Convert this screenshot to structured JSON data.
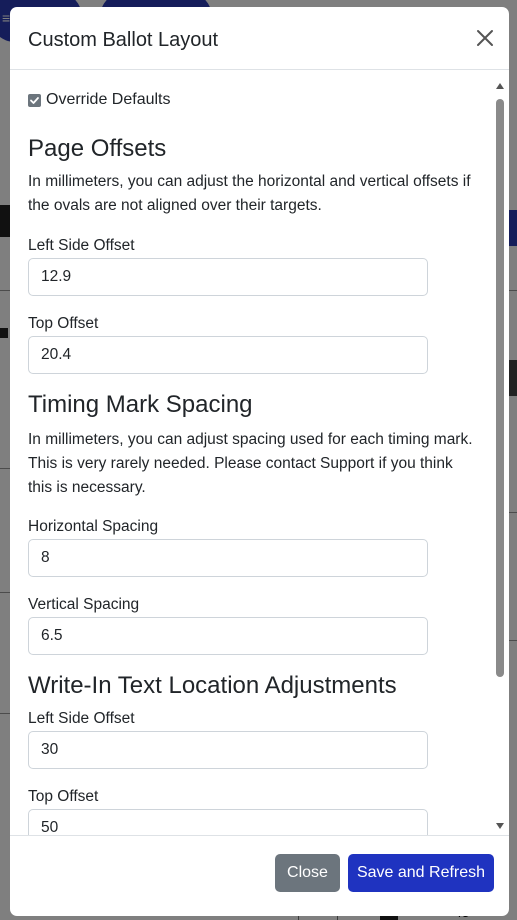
{
  "background": {
    "pill_label": "≡ R",
    "page_number": "45"
  },
  "modal": {
    "title": "Custom Ballot Layout",
    "override_defaults": {
      "label": "Override Defaults",
      "checked": true
    },
    "page_offsets": {
      "title": "Page Offsets",
      "help": "In millimeters, you can adjust the horizontal and vertical offsets if the ovals are not aligned over their targets.",
      "left_label": "Left Side Offset",
      "left_value": "12.9",
      "top_label": "Top Offset",
      "top_value": "20.4"
    },
    "timing_mark_spacing": {
      "title": "Timing Mark Spacing",
      "help": "In millimeters, you can adjust spacing used for each timing mark. This is very rarely needed. Please contact Support if you think this is necessary.",
      "horizontal_label": "Horizontal Spacing",
      "horizontal_value": "8",
      "vertical_label": "Vertical Spacing",
      "vertical_value": "6.5"
    },
    "write_in": {
      "title": "Write-In Text Location Adjustments",
      "left_label": "Left Side Offset",
      "left_value": "30",
      "top_label": "Top Offset",
      "top_value": "50"
    },
    "footer": {
      "close_label": "Close",
      "save_label": "Save and Refresh"
    }
  },
  "colors": {
    "primary": "#1f33c0",
    "secondary": "#6c757d",
    "border": "#ced4da"
  }
}
